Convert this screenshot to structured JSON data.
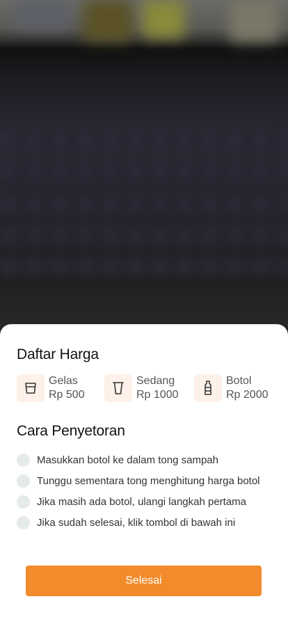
{
  "price_list": {
    "title": "Daftar Harga",
    "items": [
      {
        "name": "Gelas",
        "price": "Rp 500",
        "icon": "glass-icon"
      },
      {
        "name": "Sedang",
        "price": "Rp 1000",
        "icon": "cup-icon"
      },
      {
        "name": "Botol",
        "price": "Rp 2000",
        "icon": "bottle-icon"
      }
    ]
  },
  "instructions": {
    "title": "Cara Penyetoran",
    "steps": [
      "Masukkan botol ke dalam tong sampah",
      "Tunggu sementara tong menghitung harga botol",
      "Jika masih ada botol, ulangi langkah pertama",
      "Jika sudah selesai, klik tombol di bawah ini"
    ]
  },
  "actions": {
    "finish_label": "Selesai"
  },
  "colors": {
    "accent": "#f28b2c",
    "icon_bg": "#fdf1e9",
    "dot": "#e5eaea"
  }
}
